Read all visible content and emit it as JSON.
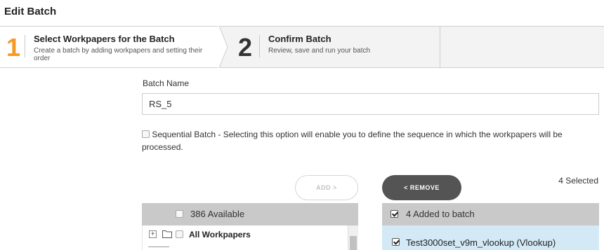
{
  "page": {
    "title": "Edit Batch"
  },
  "wizard": {
    "steps": [
      {
        "number": "1",
        "title": "Select Workpapers for the Batch",
        "description": "Create a batch by adding workpapers and setting their order",
        "active": true
      },
      {
        "number": "2",
        "title": "Confirm Batch",
        "description": "Review, save and run your batch",
        "active": false
      }
    ],
    "active_color": "#f59a24"
  },
  "form": {
    "batch_name_label": "Batch Name",
    "batch_name_value": "RS_5",
    "sequential_checked": false,
    "sequential_label": "Sequential Batch - Selecting this option will enable you to define the sequence in which the workpapers will be processed."
  },
  "actions": {
    "add_label": "ADD >",
    "remove_label": "< REMOVE",
    "selected_count": "4 Selected"
  },
  "available": {
    "header": "386 Available",
    "header_checked": false,
    "tree": [
      {
        "label": "All Workpapers",
        "expander": "+",
        "icon": "folder-icon",
        "checked": false
      }
    ]
  },
  "added": {
    "header": "4 Added to batch",
    "header_checked": true,
    "items": [
      {
        "label": "Test3000set_v9m_vlookup (Vlookup)",
        "checked": true
      }
    ],
    "highlight_color": "#d3eaf6"
  }
}
